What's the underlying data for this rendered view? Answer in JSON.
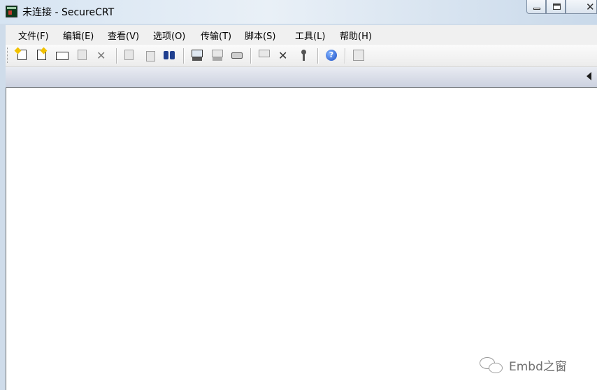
{
  "window": {
    "title": "未连接 - SecureCRT",
    "close_glyph": "✕"
  },
  "menu": {
    "items": [
      {
        "label": "文件(F)"
      },
      {
        "label": "编辑(E)"
      },
      {
        "label": "查看(V)"
      },
      {
        "label": "选项(O)"
      },
      {
        "label": "传输(T)"
      },
      {
        "label": "脚本(S)"
      },
      {
        "label": "工具(L)"
      },
      {
        "label": "帮助(H)"
      }
    ]
  },
  "toolbar": {
    "help_glyph": "?",
    "disabled_x_glyph": "✕",
    "icons": [
      "quick-connect-icon",
      "connect-icon",
      "connect-in-tab-icon",
      "reconnect-icon",
      "disconnect-icon",
      "copy-icon",
      "paste-icon",
      "find-icon",
      "print-screen-icon",
      "print-selection-icon",
      "print-icon",
      "session-options-icon",
      "global-options-icon",
      "public-key-icon",
      "help-icon",
      "keymap-icon"
    ]
  },
  "watermark": {
    "text": "Embd之窗"
  },
  "colors": {
    "title_gradient": "#d6e4f2",
    "menubar_bg": "#f0f0f0",
    "tabstrip_bg": "#cdd2e0",
    "terminal_bg": "#ffffff",
    "help_blue": "#1c4fc4"
  }
}
